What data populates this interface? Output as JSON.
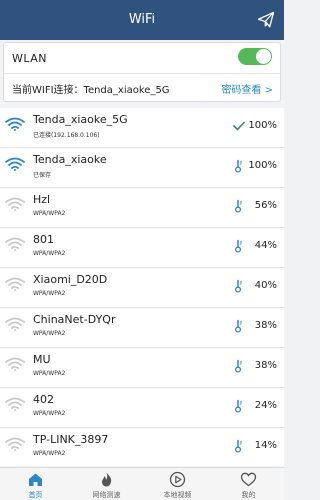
{
  "header": {
    "title": "WiFi",
    "send_icon": "paper-plane-icon"
  },
  "wlan": {
    "label": "WLAN",
    "enabled": true,
    "current_label": "当前WIFI连接：Tenda_xiaoke_5G",
    "password_link": "密码查看 >"
  },
  "colors": {
    "header": "#2f527e",
    "accent": "#2b87c7",
    "toggle": "#57b85a",
    "wifi_active": "#2b87c7",
    "wifi_inactive": "#c9c9c9"
  },
  "networks": [
    {
      "name": "Tenda_xiaoke_5G",
      "sub": "已连接(192.168.0.106)",
      "signal": "100%",
      "status_icon": "check-icon",
      "active": true
    },
    {
      "name": "Tenda_xiaoke",
      "sub": "已保存",
      "signal": "100%",
      "status_icon": "thermometer-icon",
      "active": true
    },
    {
      "name": "Hzl",
      "sub": "WPA/WPA2",
      "signal": "56%",
      "status_icon": "thermometer-icon",
      "active": false
    },
    {
      "name": "801",
      "sub": "WPA/WPA2",
      "signal": "44%",
      "status_icon": "thermometer-icon",
      "active": false
    },
    {
      "name": "Xiaomi_D20D",
      "sub": "WPA/WPA2",
      "signal": "40%",
      "status_icon": "thermometer-icon",
      "active": false
    },
    {
      "name": "ChinaNet-DYQr",
      "sub": "WPA/WPA2",
      "signal": "38%",
      "status_icon": "thermometer-icon",
      "active": false
    },
    {
      "name": "MU",
      "sub": "WPA/WPA2",
      "signal": "38%",
      "status_icon": "thermometer-icon",
      "active": false
    },
    {
      "name": "402",
      "sub": "WPA/WPA2",
      "signal": "24%",
      "status_icon": "thermometer-icon",
      "active": false
    },
    {
      "name": "TP-LINK_3897",
      "sub": "WPA/WPA2",
      "signal": "14%",
      "status_icon": "thermometer-icon",
      "active": false
    }
  ],
  "tabs": [
    {
      "label": "首页",
      "icon": "home-icon",
      "active": true
    },
    {
      "label": "网络测速",
      "icon": "flame-icon",
      "active": false
    },
    {
      "label": "本地视频",
      "icon": "play-icon",
      "active": false
    },
    {
      "label": "我的",
      "icon": "heart-icon",
      "active": false
    }
  ]
}
